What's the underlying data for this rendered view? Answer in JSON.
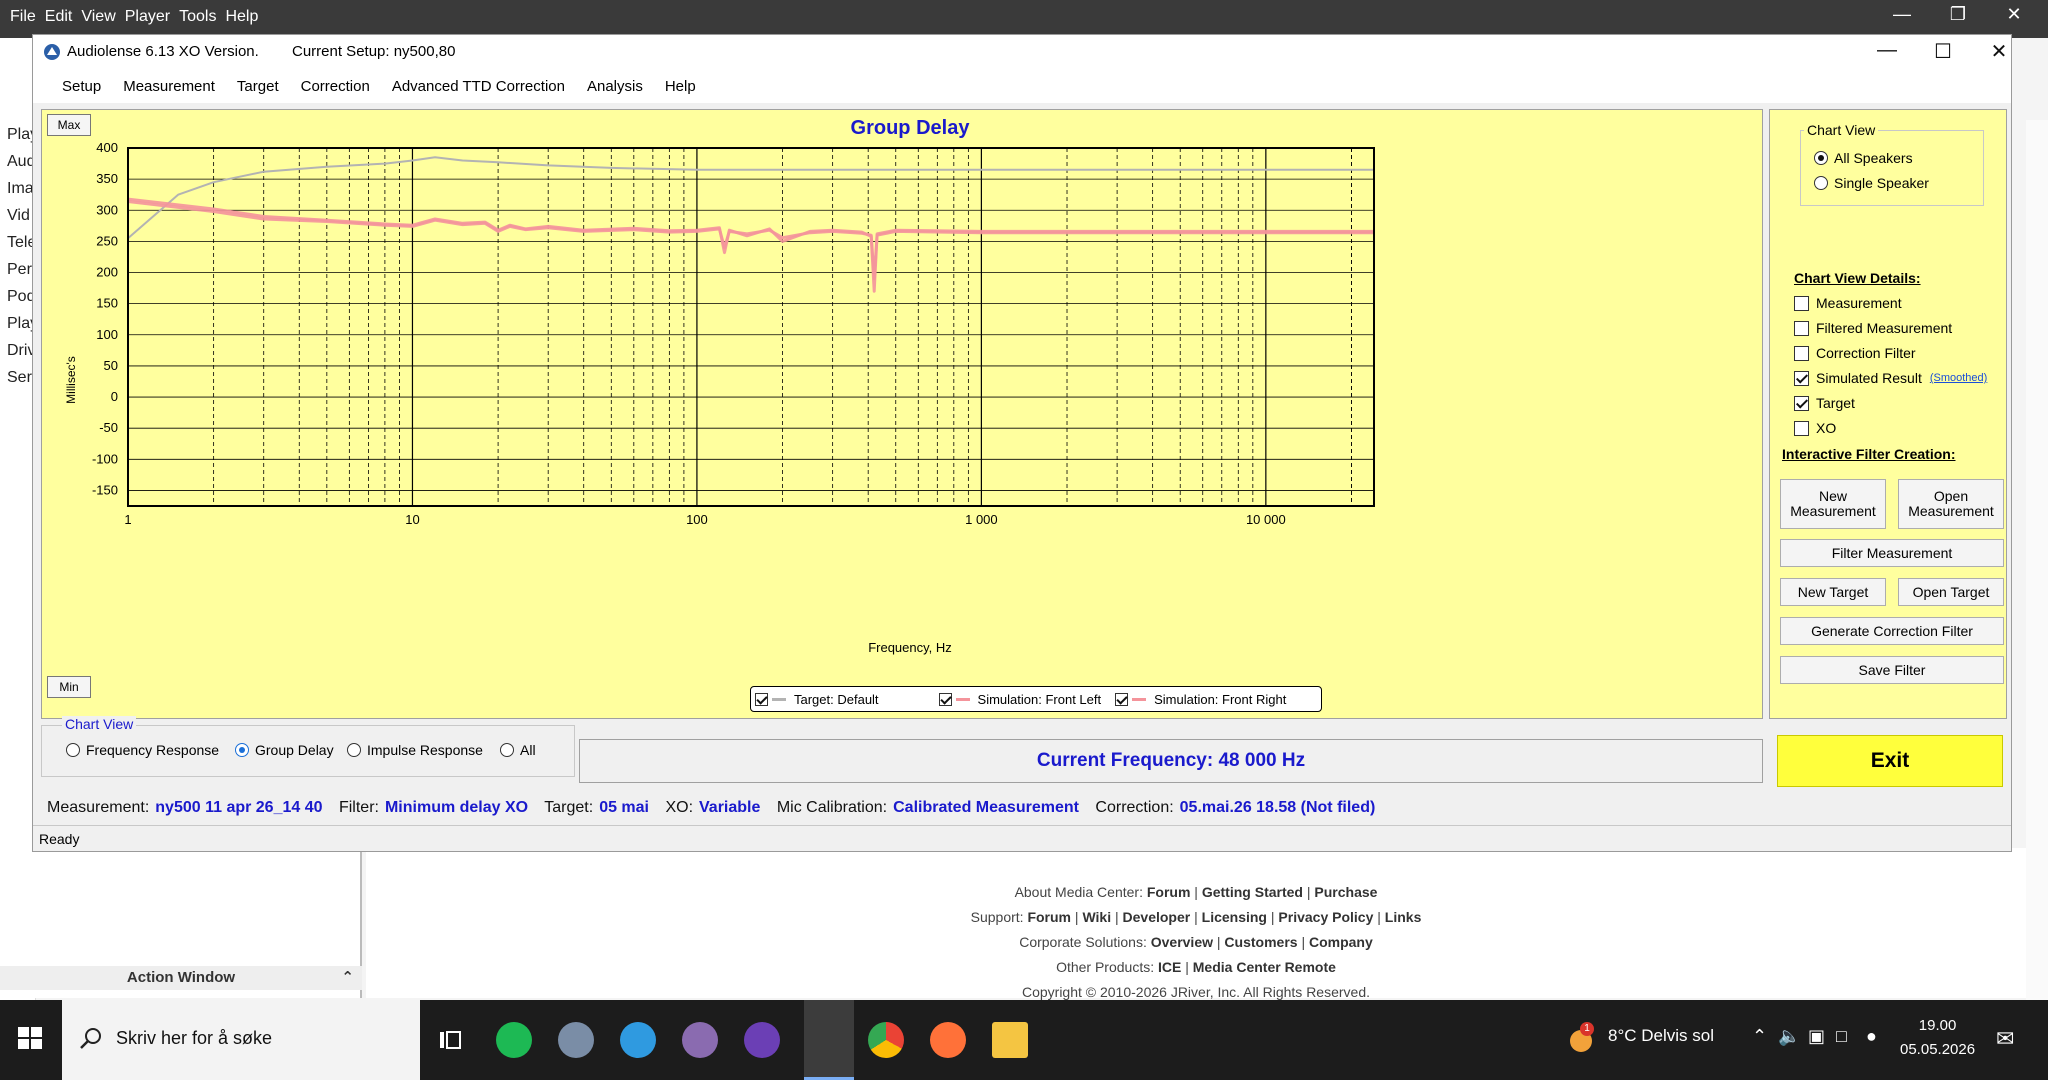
{
  "bg": {
    "menu": [
      "File",
      "Edit",
      "View",
      "Player",
      "Tools",
      "Help"
    ],
    "left_items": [
      "Play",
      "Aud",
      "Ima",
      "Vid",
      "Tele",
      "Per",
      "Pod",
      "Play",
      "Driv",
      "Ser"
    ],
    "action_window": "Action Window",
    "footer": [
      {
        "label": "About Media Center:",
        "links": [
          "Forum",
          "Getting Started",
          "Purchase"
        ]
      },
      {
        "label": "Support:",
        "links": [
          "Forum",
          "Wiki",
          "Developer",
          "Licensing",
          "Privacy Policy",
          "Links"
        ]
      },
      {
        "label": "Corporate Solutions:",
        "links": [
          "Overview",
          "Customers",
          "Company"
        ]
      },
      {
        "label": "Other Products:",
        "links": [
          "ICE",
          "Media Center Remote"
        ]
      }
    ],
    "copyright": "Copyright © 2010-2026 JRiver, Inc. All Rights Reserved."
  },
  "window": {
    "title": "Audiolense 6.13 XO Version.",
    "setup": "Current Setup: ny500,80",
    "menu": [
      "Setup",
      "Measurement",
      "Target",
      "Correction",
      "Advanced TTD Correction",
      "Analysis",
      "Help"
    ]
  },
  "chart_data": {
    "type": "line",
    "title": "Group Delay",
    "xlabel": "Frequency, Hz",
    "ylabel": "Millisec's",
    "xscale": "log",
    "xlim": [
      1,
      24000
    ],
    "ylim": [
      -175,
      400
    ],
    "xticks": [
      1,
      10,
      100,
      1000,
      10000
    ],
    "xtick_labels": [
      "1",
      "10",
      "100",
      "1 000",
      "10 000"
    ],
    "yticks": [
      400,
      350,
      300,
      250,
      200,
      150,
      100,
      50,
      0,
      -50,
      -100,
      -150
    ],
    "grid": true,
    "legend_position": "bottom-center",
    "series": [
      {
        "name": "Target: Default",
        "color": "#b3b3b3",
        "x": [
          1,
          1.5,
          2,
          3,
          5,
          8,
          10,
          12,
          15,
          20,
          30,
          50,
          100,
          200,
          500,
          1000,
          24000
        ],
        "y": [
          255,
          325,
          345,
          362,
          370,
          375,
          380,
          385,
          380,
          377,
          372,
          368,
          365,
          365,
          365,
          365,
          365
        ]
      },
      {
        "name": "Simulation: Front Left",
        "color": "#f4949b",
        "x": [
          1,
          2,
          3,
          5,
          8,
          10,
          12,
          15,
          18,
          20,
          22,
          25,
          30,
          40,
          60,
          80,
          100,
          120,
          125,
          130,
          150,
          180,
          200,
          250,
          300,
          380,
          410,
          420,
          430,
          500,
          1000,
          5000,
          24000
        ],
        "y": [
          318,
          302,
          290,
          284,
          278,
          276,
          286,
          279,
          281,
          268,
          276,
          270,
          274,
          268,
          271,
          267,
          268,
          272,
          232,
          268,
          259,
          270,
          250,
          266,
          268,
          265,
          258,
          170,
          262,
          268,
          266,
          266,
          266
        ]
      },
      {
        "name": "Simulation: Front Right",
        "color": "#f4949b",
        "x": [
          1,
          2,
          3,
          5,
          8,
          10,
          12,
          15,
          18,
          20,
          22,
          25,
          30,
          40,
          60,
          80,
          100,
          120,
          125,
          130,
          150,
          180,
          200,
          250,
          300,
          380,
          410,
          420,
          430,
          500,
          1000,
          5000,
          24000
        ],
        "y": [
          314,
          298,
          286,
          282,
          276,
          274,
          284,
          277,
          279,
          266,
          274,
          269,
          272,
          266,
          269,
          265,
          266,
          270,
          240,
          266,
          262,
          268,
          256,
          264,
          266,
          263,
          260,
          190,
          260,
          266,
          264,
          264,
          264
        ]
      }
    ]
  },
  "chart": {
    "max_label": "Max",
    "min_label": "Min"
  },
  "legend": {
    "items": [
      "Target: Default",
      "Simulation: Front Left",
      "Simulation: Front Right"
    ]
  },
  "right": {
    "chart_view_title": "Chart View",
    "all_speakers": "All Speakers",
    "single_speaker": "Single Speaker",
    "details_title": "Chart View Details:",
    "details": [
      {
        "label": "Measurement",
        "checked": false
      },
      {
        "label": "Filtered Measurement",
        "checked": false
      },
      {
        "label": "Correction Filter",
        "checked": false
      },
      {
        "label": "Simulated Result",
        "checked": true
      },
      {
        "label": "Target",
        "checked": true
      },
      {
        "label": "XO",
        "checked": false
      }
    ],
    "smoothed": "(Smoothed)",
    "interactive_title": "Interactive Filter Creation:",
    "btn_new_measurement": "New Measurement",
    "btn_open_measurement": "Open Measurement",
    "btn_filter_measurement": "Filter Measurement",
    "btn_new_target": "New Target",
    "btn_open_target": "Open Target",
    "btn_generate": "Generate Correction Filter",
    "btn_save": "Save Filter"
  },
  "bottom": {
    "chart_view_title": "Chart View",
    "options": [
      "Frequency Response",
      "Group Delay",
      "Impulse Response",
      "All"
    ],
    "selected": "Group Delay",
    "current_frequency": "Current Frequency: 48 000 Hz",
    "exit": "Exit"
  },
  "info": {
    "measurement_k": "Measurement:",
    "measurement_v": "ny500 11 apr 26_14 40",
    "filter_k": "Filter:",
    "filter_v": "Minimum delay XO",
    "target_k": "Target:",
    "target_v": "05 mai",
    "xo_k": "XO:",
    "xo_v": "Variable",
    "mic_k": "Mic Calibration:",
    "mic_v": "Calibrated Measurement",
    "correction_k": "Correction:",
    "correction_v": "05.mai.26 18.58 (Not filed)"
  },
  "status": "Ready",
  "taskbar": {
    "search_placeholder": "Skriv her for å søke",
    "weather": "8°C  Delvis sol",
    "time": "19.00",
    "date": "05.05.2026",
    "notif_badge": "1"
  },
  "colors": {
    "chart_bg": "#ffff9e",
    "accent_blue": "#1a1acc",
    "exit_yellow": "#ffff3c",
    "sim_pink": "#f4949b",
    "target_grey": "#b3b3b3"
  }
}
